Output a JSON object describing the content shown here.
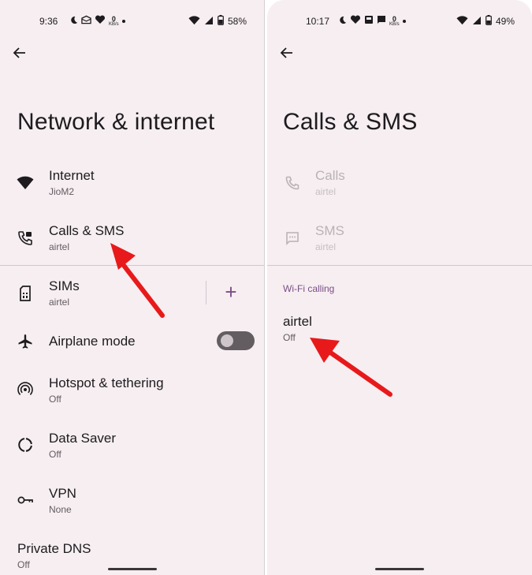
{
  "left": {
    "statusbar": {
      "time": "9:36",
      "kbs_value": "0",
      "kbs_unit": "KB/s",
      "battery": "58%"
    },
    "title": "Network & internet",
    "items": [
      {
        "label": "Internet",
        "sub": "JioM2",
        "icon": "wifi-icon"
      },
      {
        "label": "Calls & SMS",
        "sub": "airtel",
        "icon": "calls-sms-icon"
      },
      {
        "label": "SIMs",
        "sub": "airtel",
        "icon": "sim-card-icon"
      },
      {
        "label": "Airplane mode",
        "sub": "",
        "icon": "airplane-icon"
      },
      {
        "label": "Hotspot & tethering",
        "sub": "Off",
        "icon": "hotspot-icon"
      },
      {
        "label": "Data Saver",
        "sub": "Off",
        "icon": "data-saver-icon"
      },
      {
        "label": "VPN",
        "sub": "None",
        "icon": "vpn-key-icon"
      },
      {
        "label": "Private DNS",
        "sub": "Off"
      }
    ],
    "airplane_mode_on": false,
    "add_sim_symbol": "+"
  },
  "right": {
    "statusbar": {
      "time": "10:17",
      "kbs_value": "0",
      "kbs_unit": "KB/s",
      "battery": "49%"
    },
    "title": "Calls & SMS",
    "items": [
      {
        "label": "Calls",
        "sub": "airtel",
        "icon": "phone-icon"
      },
      {
        "label": "SMS",
        "sub": "airtel",
        "icon": "message-icon"
      }
    ],
    "section_header": "Wi-Fi calling",
    "wifi_calling": {
      "label": "airtel",
      "sub": "Off"
    }
  },
  "colors": {
    "background": "#f6eef1",
    "accent": "#7b4e86",
    "annotation_arrow": "#e8191b"
  }
}
